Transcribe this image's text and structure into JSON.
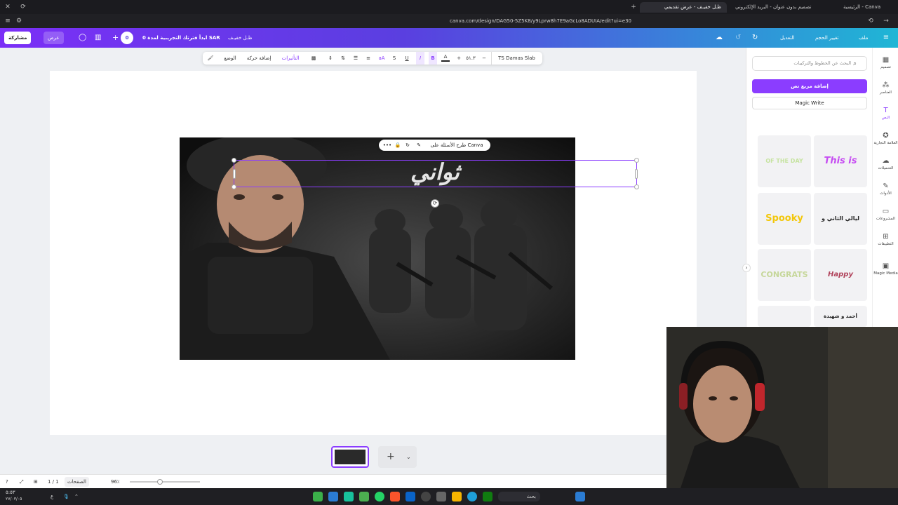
{
  "browser": {
    "tabs": [
      {
        "label": "الرئيسية - Canva",
        "active": false
      },
      {
        "label": "تصميم بدون عنوان - البريد الإلكتروني",
        "active": false
      },
      {
        "label": "ظـل خفيـف - عرض تقديمي",
        "active": true
      }
    ],
    "url": "canva.com/design/DAG50-5Z5K8/y9Lprw8h7E9aGcLo8ADUIA/edit?ui=e30"
  },
  "header": {
    "menu_file": "ملف",
    "menu_resize": "تغيير الحجم",
    "menu_edit": "التعديل",
    "design_title": "ظـل خفيـف",
    "trial_label": "ابدأ فترتك التجريبية لمدة 0 SAR",
    "zero_badge": "0",
    "present_label": "عرض",
    "share_label": "مشاركة"
  },
  "text_toolbar": {
    "font_name": "TS Damas Slab",
    "font_size": "٥١.٣",
    "effects_label": "التأثيرات",
    "animate_label": "إضافة حركة",
    "position_label": "الوضع",
    "bold": "B",
    "italic": "I",
    "underline": "U",
    "strike": "S",
    "case": "aA",
    "color": "A",
    "minus": "−",
    "plus": "+"
  },
  "canvas": {
    "headline_text": "ثواني",
    "ask_canva_label": "طرح الأسئلة على Canva",
    "more_label": "•••",
    "rotate_icon": "⟳"
  },
  "right_panel": {
    "search_placeholder": "البحث عن الخطوط والتركيبات",
    "add_textbox_label": "إضافة مربع نص",
    "magic_write_label": "Magic Write",
    "tiles": [
      {
        "text": "OF THE DAY",
        "color": "#c6e3a0"
      },
      {
        "text": "This is perfect",
        "color": "#c64cf2"
      },
      {
        "text": "Spooky",
        "color": "#f3c70a"
      },
      {
        "text": "ليالي الثاني و العود",
        "color": "#222222"
      },
      {
        "text": "CONGRATS",
        "color": "#c6d79a"
      },
      {
        "text": "Happy Birthday",
        "color": "#b0425a"
      },
      {
        "text": "",
        "color": "#999999"
      },
      {
        "text": "أحمد و شهيدة",
        "color": "#222222"
      }
    ]
  },
  "icon_rail": [
    {
      "icon": "design-icon",
      "glyph": "▦",
      "label": "تصميم"
    },
    {
      "icon": "elements-icon",
      "glyph": "⁂",
      "label": "العناصر"
    },
    {
      "icon": "text-icon",
      "glyph": "T",
      "label": "النص"
    },
    {
      "icon": "brand-icon",
      "glyph": "✪",
      "label": "العلامة التجارية"
    },
    {
      "icon": "uploads-icon",
      "glyph": "☁",
      "label": "التحميلات"
    },
    {
      "icon": "tools-icon",
      "glyph": "✎",
      "label": "الأدوات"
    },
    {
      "icon": "projects-icon",
      "glyph": "▭",
      "label": "المشروعات"
    },
    {
      "icon": "apps-icon",
      "glyph": "⊞",
      "label": "التطبيقات"
    },
    {
      "icon": "magic-media-icon",
      "glyph": "▣",
      "label": "Magic Media"
    }
  ],
  "bottom_bar": {
    "pages_label": "الصفحات",
    "page_count": "1 / 1",
    "zoom": "96٪"
  },
  "taskbar": {
    "search_label": "بحث",
    "time": "٥:٥٣",
    "date": "٢٧/٠٣/٠٥",
    "lang": "ع"
  }
}
